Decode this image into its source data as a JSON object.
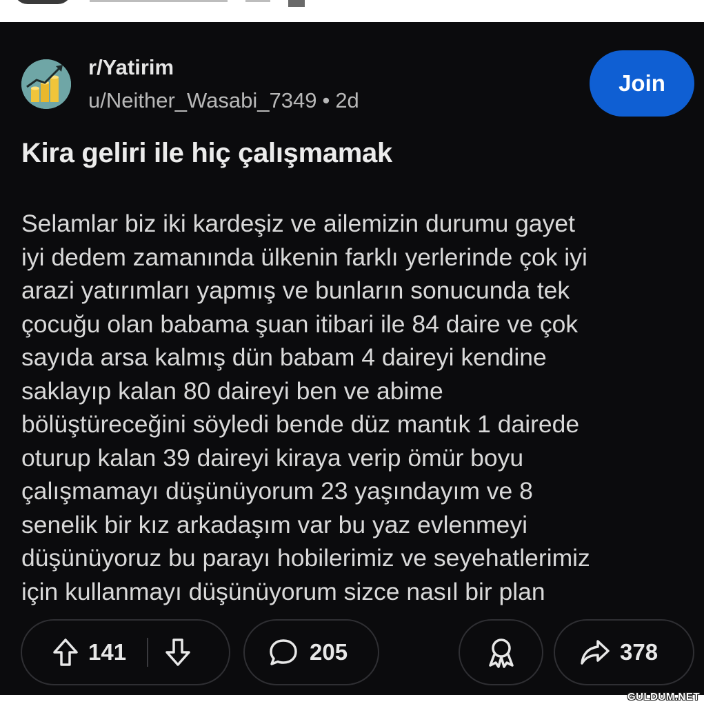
{
  "post": {
    "subreddit": "r/Yatirim",
    "author": "u/Neither_Wasabi_7349",
    "separator": "•",
    "age": "2d",
    "join_label": "Join",
    "title": "Kira geliri ile hiç çalışmamak",
    "body_lines": [
      "Selamlar biz iki kardeşiz ve ailemizin durumu gayet",
      "iyi dedem zamanında ülkenin farklı yerlerinde çok iyi",
      "arazi yatırımları yapmış ve bunların sonucunda tek",
      "çocuğu olan babama şuan itibari ile 84 daire ve çok",
      "sayıda arsa kalmış dün babam 4 daireyi kendine",
      "saklayıp kalan 80 daireyi ben ve abime",
      "bölüştüreceğini söyledi bende düz mantık 1 dairede",
      "oturup kalan 39 daireyi kiraya verip ömür boyu",
      "çalışmamayı düşünüyorum 23 yaşındayım ve 8",
      "senelik bir kız arkadaşım var bu yaz evlenmeyi",
      "düşünüyoruz bu parayı hobilerimiz ve seyehatlerimiz",
      "için kullanmayı düşünüyorum sizce nasıl bir plan"
    ]
  },
  "actions": {
    "upvotes": "141",
    "comments": "205",
    "shares": "378"
  },
  "icons": {
    "avatar": "subreddit-avatar",
    "upvote": "upvote-arrow-icon",
    "downvote": "downvote-arrow-icon",
    "comment": "comment-bubble-icon",
    "award": "award-icon",
    "share": "share-arrow-icon"
  },
  "colors": {
    "background": "#0b0b0d",
    "join_button": "#0f5fd3",
    "text": "#d9d9d9"
  },
  "watermark": "GULDUM.NET"
}
